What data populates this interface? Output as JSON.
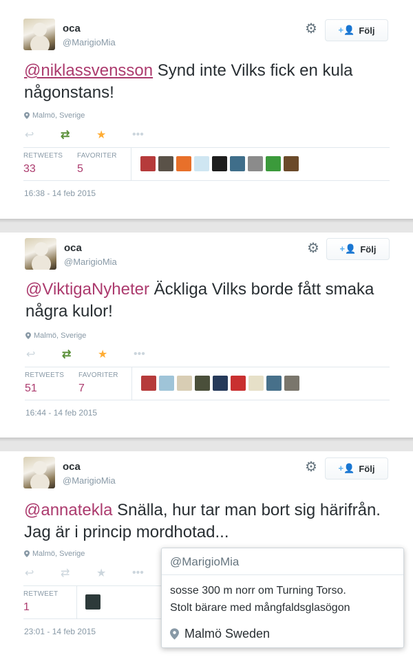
{
  "colors": {
    "mention": "#ac3b6e",
    "retweet": "#5c913b",
    "favorite": "#ffac33",
    "meta": "#8899a6"
  },
  "tweets": [
    {
      "name": "oca",
      "handle": "@MarigioMia",
      "follow_label": "Följ",
      "mention": "@niklassvensson",
      "body": "Synd inte Vilks fick en kula någonstans!",
      "location": "Malmö, Sverige",
      "stats": [
        {
          "label": "RETWEETS",
          "value": "33"
        },
        {
          "label": "FAVORITER",
          "value": "5"
        }
      ],
      "favoriters": [
        "#b63b3b",
        "#5a5248",
        "#e8702a",
        "#cfe6f2",
        "#1d1d1d",
        "#3f6e8a",
        "#8b8b8b",
        "#3b9a3b",
        "#6b4a2a"
      ],
      "timestamp": "16:38 - 14 feb 2015"
    },
    {
      "name": "oca",
      "handle": "@MarigioMia",
      "follow_label": "Följ",
      "mention": "@ViktigaNyheter",
      "body": "Äckliga Vilks borde fått smaka några kulor!",
      "location": "Malmö, Sverige",
      "stats": [
        {
          "label": "RETWEETS",
          "value": "51"
        },
        {
          "label": "FAVORITER",
          "value": "7"
        }
      ],
      "favoriters": [
        "#b63b3b",
        "#9fc4d8",
        "#d8cdb4",
        "#4a4f3a",
        "#263a5a",
        "#c93030",
        "#e6e0c8",
        "#47708a",
        "#7a766c"
      ],
      "timestamp": "16:44 - 14 feb 2015"
    },
    {
      "name": "oca",
      "handle": "@MarigioMia",
      "follow_label": "Följ",
      "mention": "@annatekla",
      "body": "Snälla, hur tar man bort sig härifrån. Jag är i princip mordhotad...",
      "location": "Malmö, Sverige",
      "stats": [
        {
          "label": "RETWEET",
          "value": "1"
        }
      ],
      "favoriters": [
        "#2d3a3a"
      ],
      "timestamp": "23:01 - 14 feb 2015"
    }
  ],
  "profile_popup": {
    "handle": "@MarigioMia",
    "bio_line1": "sosse 300 m norr om Turning Torso.",
    "bio_line2": "Stolt bärare med mångfaldsglasögon",
    "location": "Malmö Sweden"
  }
}
